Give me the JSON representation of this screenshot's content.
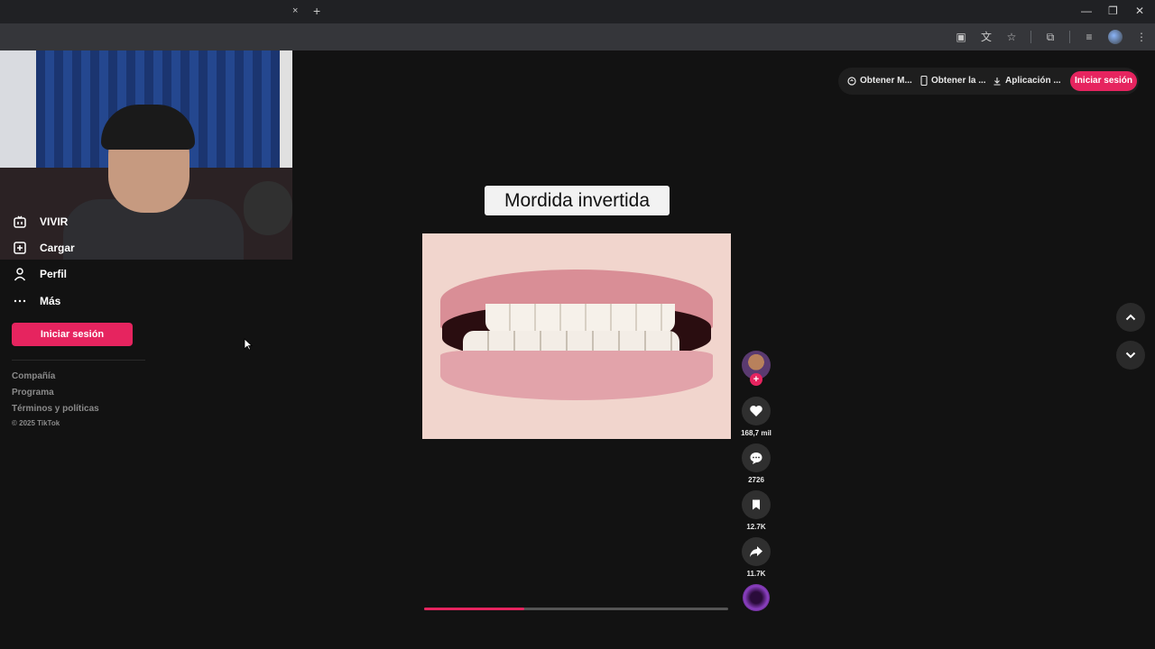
{
  "browser": {
    "tab_close": "×",
    "new_tab": "+",
    "window_controls": {
      "minimize": "—",
      "restore": "❐",
      "close": "✕"
    }
  },
  "sidebar": {
    "items": [
      {
        "label": "VIVIR",
        "icon": "live-icon"
      },
      {
        "label": "Cargar",
        "icon": "upload-icon"
      },
      {
        "label": "Perfil",
        "icon": "profile-icon"
      },
      {
        "label": "Más",
        "icon": "more-icon"
      }
    ],
    "login_label": "Iniciar sesión",
    "footer": {
      "company": "Compañía",
      "program": "Programa",
      "terms": "Términos y políticas",
      "copyright": "© 2025 TikTok"
    }
  },
  "topbar": {
    "item1": "Obtener M...",
    "item2": "Obtener la ...",
    "item3": "Aplicación ...",
    "login_label": "Iniciar sesión"
  },
  "video": {
    "caption": "Mordida invertida",
    "progress": 0.33
  },
  "actions": {
    "likes": "168,7 mil",
    "comments": "2726",
    "saves": "12.7K",
    "shares": "11.7K"
  },
  "colors": {
    "accent": "#e6245f",
    "background": "#121212"
  }
}
